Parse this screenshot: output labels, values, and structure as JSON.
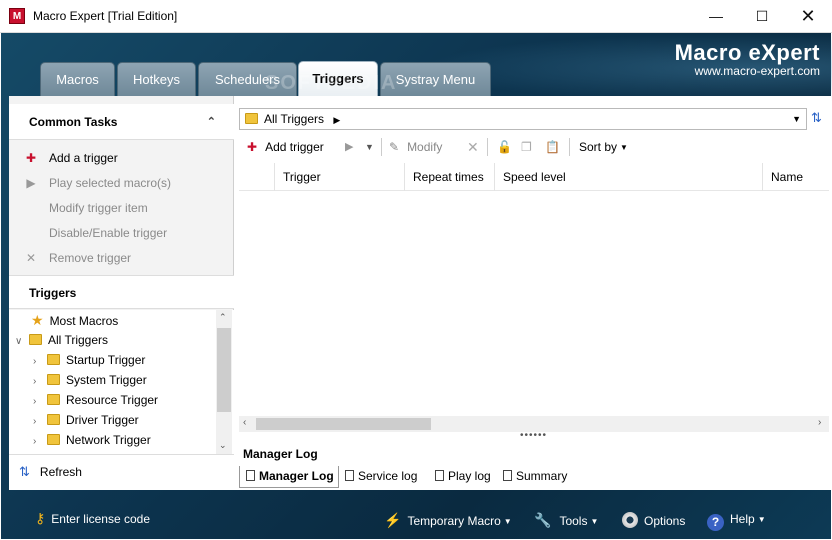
{
  "window": {
    "title": "Macro Expert [Trial Edition]",
    "app_icon_letter": "M"
  },
  "brand": {
    "name": "Macro eXpert",
    "url": "www.macro-expert.com"
  },
  "watermark": "SOFTPEDIA",
  "tabs": [
    {
      "label": "Macros"
    },
    {
      "label": "Hotkeys"
    },
    {
      "label": "Schedulers"
    },
    {
      "label": "Triggers",
      "active": true
    },
    {
      "label": "Systray Menu"
    }
  ],
  "common_tasks": {
    "title": "Common Tasks",
    "items": [
      {
        "label": "Add a trigger",
        "icon": "add-trigger-icon",
        "enabled": true
      },
      {
        "label": "Play selected macro(s)",
        "icon": "play-icon",
        "enabled": false
      },
      {
        "label": "Modify trigger item",
        "icon": "",
        "enabled": false
      },
      {
        "label": "Disable/Enable trigger",
        "icon": "",
        "enabled": false
      },
      {
        "label": "Remove trigger",
        "icon": "close-icon",
        "enabled": false
      }
    ]
  },
  "triggers_tree": {
    "title": "Triggers",
    "items": [
      {
        "label": "Most Macros",
        "icon": "star-icon"
      },
      {
        "label": "All Triggers",
        "icon": "folder-icon",
        "expanded": true
      },
      {
        "label": "Startup Trigger",
        "icon": "folder-icon"
      },
      {
        "label": "System Trigger",
        "icon": "folder-icon"
      },
      {
        "label": "Resource Trigger",
        "icon": "folder-icon"
      },
      {
        "label": "Driver Trigger",
        "icon": "folder-icon"
      },
      {
        "label": "Network Trigger",
        "icon": "folder-icon"
      }
    ]
  },
  "refresh_label": "Refresh",
  "address_bar": {
    "path": "All Triggers"
  },
  "toolbar": {
    "add_label": "Add trigger",
    "modify_label": "Modify",
    "sort_label": "Sort by"
  },
  "grid": {
    "columns": [
      "Trigger",
      "Repeat times",
      "Speed level",
      "Name"
    ]
  },
  "manager_log": {
    "title": "Manager Log",
    "tabs": [
      "Manager Log",
      "Service log",
      "Play log",
      "Summary"
    ]
  },
  "statusbar": {
    "license": "Enter license code",
    "temp_macro": "Temporary Macro",
    "tools": "Tools",
    "options": "Options",
    "help": "Help"
  },
  "colors": {
    "frame": "#0d3550",
    "active_tab": "#ffffff",
    "brand_text": "#ffffff"
  }
}
